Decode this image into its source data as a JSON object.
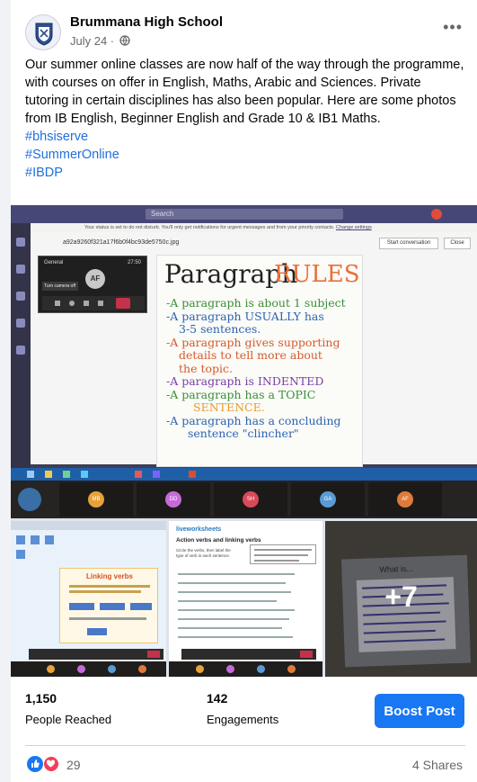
{
  "post": {
    "author": "Brummana High School",
    "date": "July 24 ·",
    "more_icon": "more-options-icon",
    "text": "Our summer online classes are now half of the way through the programme, with courses on offer in English, Maths, Arabic and Sciences. Private tutoring in certain disciplines has also been popular. Here are some photos from IB English, Beginner English and Grade 10 & IB1 Maths.",
    "hashtags": [
      "#bhsiserve",
      "#SummerOnline",
      "#IBDP"
    ]
  },
  "main_image": {
    "search": "Search",
    "notice": "Your status is set to do not disturb. You'll only get notifications for urgent messages and from your priority contacts.",
    "notice_link": "Change settings",
    "file_name": "a92a9260f321a17f6b0f4bc93de5750c.jpg",
    "start_conversation": "Start conversation",
    "close": "Close",
    "call_label": "General",
    "call_time": "27:50",
    "caller_initials": "AF",
    "turn_camera": "Turn camera off",
    "poster_title_1": "Paragraph",
    "poster_title_2": "RULES",
    "poster_lines": [
      "-A paragraph is about 1 subject",
      "-A paragraph USUALLY has",
      "3-5 sentences.",
      "-A paragraph gives supporting",
      "details to tell more about",
      "the topic.",
      "-A paragraph is INDENTED",
      "-A paragraph has a TOPIC",
      "SENTENCE.",
      "-A paragraph has a concluding",
      "sentence \"clincher\""
    ],
    "participants": [
      "MB",
      "DD",
      "SH",
      "GA",
      "AF"
    ]
  },
  "thumb1": {
    "title": "Linking verbs"
  },
  "thumb2": {
    "brand": "liveworksheets",
    "title": "Action verbs and linking verbs",
    "instructions": "Circle the verbs, then label the type of verb in each sentence."
  },
  "thumb3": {
    "more_label": "+7",
    "hidden_title": "What is..."
  },
  "stats": {
    "reached_value": "1,150",
    "reached_label": "People Reached",
    "engagements_value": "142",
    "engagements_label": "Engagements",
    "boost_label": "Boost Post"
  },
  "footer": {
    "reactions_count": "29",
    "shares": "4 Shares",
    "colors": {
      "like": "#1877f2",
      "love": "#f33e58"
    }
  }
}
